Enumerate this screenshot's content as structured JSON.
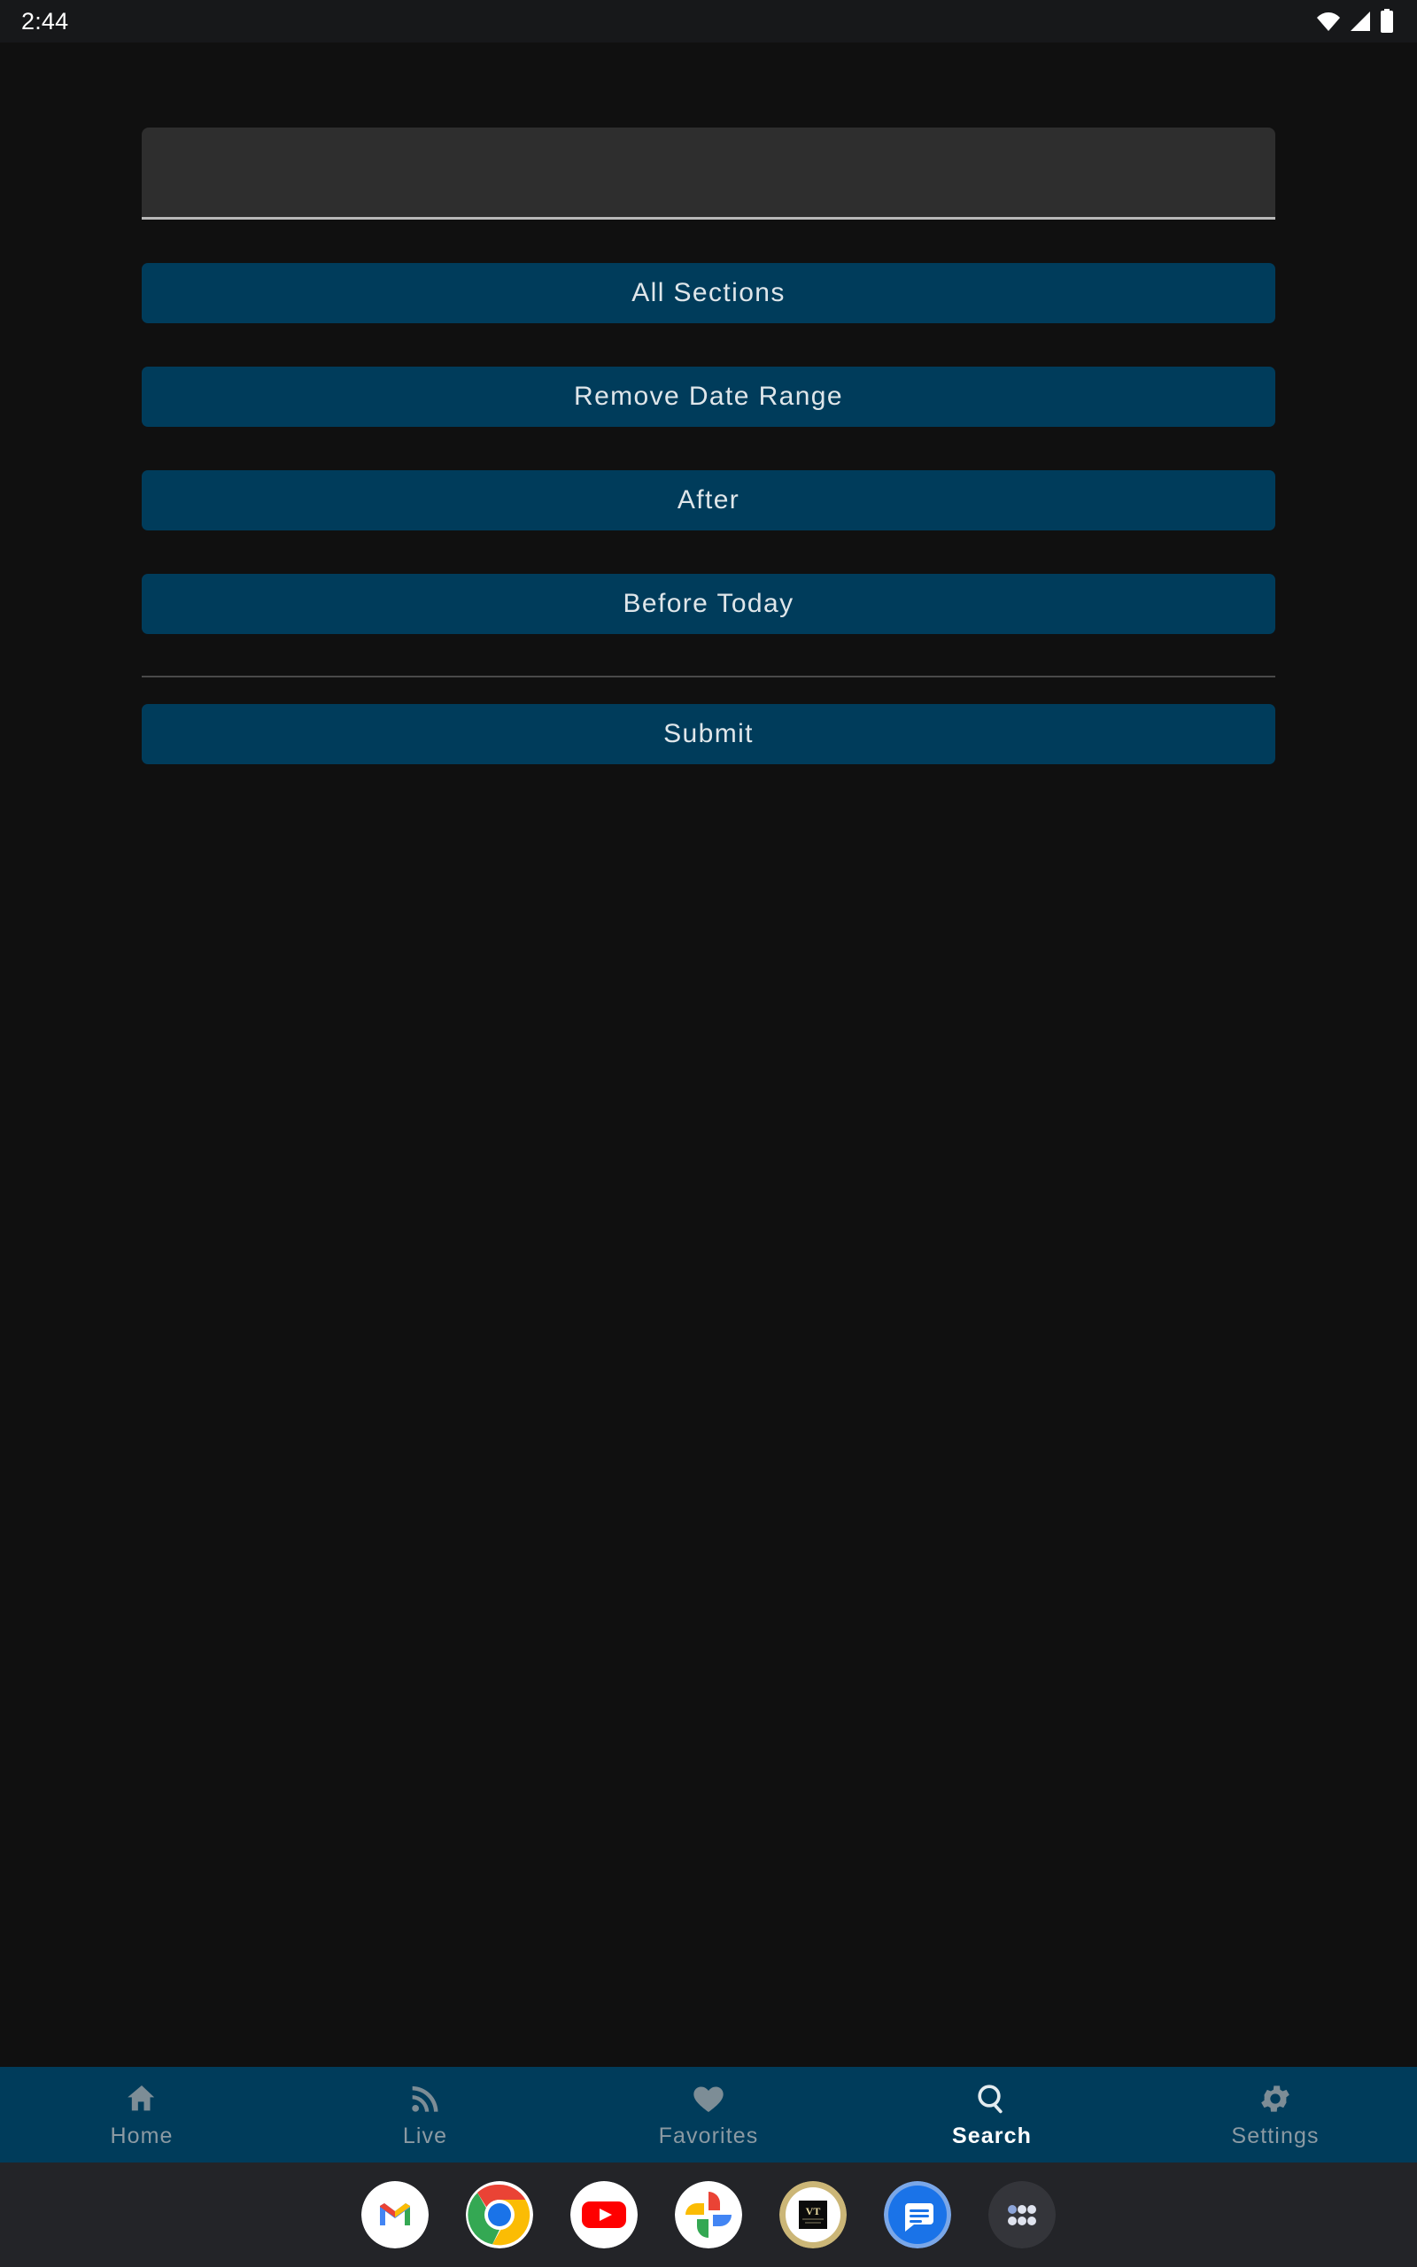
{
  "status_bar": {
    "clock": "2:44",
    "icons": [
      "wifi-icon",
      "cellular-signal-icon",
      "battery-icon"
    ]
  },
  "colors": {
    "page_background": "#101010",
    "status_bar_background": "#17181a",
    "button_background": "#003c5b",
    "button_text": "#dfe6ea",
    "field_background": "#2e2e2e",
    "field_underline": "#b8b8b8",
    "divider": "#4a4a4a",
    "tab_bar_background": "#003c5b",
    "tab_inactive": "#8b9aa3",
    "tab_active": "#ffffff",
    "dock_background": "#232428"
  },
  "form": {
    "search_input": {
      "value": "",
      "placeholder": ""
    },
    "buttons": [
      {
        "label": "All Sections",
        "name": "all-sections-button"
      },
      {
        "label": "Remove Date Range",
        "name": "remove-date-range-button"
      },
      {
        "label": "After",
        "name": "after-button"
      },
      {
        "label": "Before Today",
        "name": "before-today-button"
      }
    ],
    "submit": {
      "label": "Submit",
      "name": "submit-button"
    }
  },
  "tab_bar": {
    "active_index": 3,
    "tabs": [
      {
        "label": "Home",
        "icon": "home-icon",
        "active": false
      },
      {
        "label": "Live",
        "icon": "broadcast-icon",
        "active": false
      },
      {
        "label": "Favorites",
        "icon": "heart-icon",
        "active": false
      },
      {
        "label": "Search",
        "icon": "search-icon",
        "active": true
      },
      {
        "label": "Settings",
        "icon": "gear-icon",
        "active": false
      }
    ]
  },
  "dock": {
    "apps": [
      {
        "name": "gmail-app-icon",
        "label": "Gmail"
      },
      {
        "name": "chrome-app-icon",
        "label": "Chrome"
      },
      {
        "name": "youtube-app-icon",
        "label": "YouTube"
      },
      {
        "name": "google-photos-app-icon",
        "label": "Photos"
      },
      {
        "name": "gold-ring-app-icon",
        "label": "App"
      },
      {
        "name": "messages-app-icon",
        "label": "Messages"
      },
      {
        "name": "app-drawer-icon",
        "label": "All apps"
      }
    ]
  }
}
